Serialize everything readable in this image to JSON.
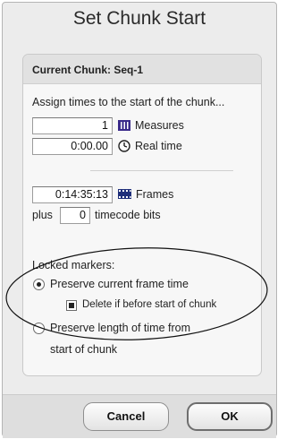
{
  "dialog": {
    "title": "Set Chunk Start",
    "group_title": "Current Chunk:  Seq-1",
    "assign_text": "Assign times to the start of the chunk...",
    "measures": {
      "value": "1",
      "label": "Measures",
      "icon": "measures-bars-icon"
    },
    "real_time": {
      "value": "0:00.00",
      "label": "Real time",
      "icon": "clock-icon"
    },
    "frames": {
      "value": "0:14:35:13",
      "label": "Frames",
      "icon": "film-frames-icon"
    },
    "timecode": {
      "prefix": "plus",
      "value": "0",
      "suffix": "timecode bits"
    },
    "locked_markers": {
      "heading": "Locked markers:",
      "preserve_frame_label": "Preserve current frame time",
      "delete_label": "Delete if before start of chunk",
      "preserve_length_label_1": "Preserve length of time from",
      "preserve_length_label_2": "start of chunk"
    },
    "buttons": {
      "cancel": "Cancel",
      "ok": "OK"
    }
  }
}
